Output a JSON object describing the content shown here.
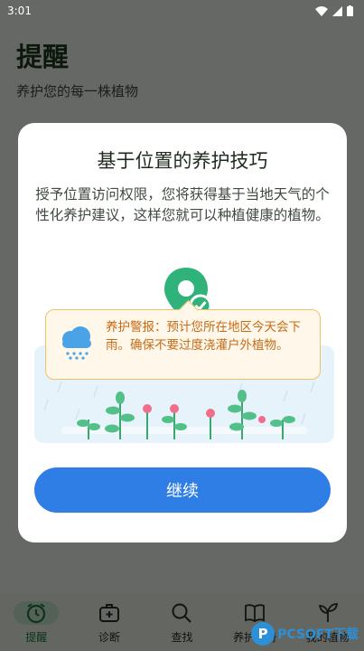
{
  "status_bar": {
    "time": "3:01"
  },
  "header": {
    "title": "提醒",
    "subtitle": "养护您的每一株植物"
  },
  "dialog": {
    "title": "基于位置的养护技巧",
    "body": "授予位置访问权限，您将获得基于当地天气的个性化养护建议，这样您就可以种植健康的植物。",
    "alert_text": "养护警报：预计您所在地区今天会下雨。确保不要过度浇灌户外植物。",
    "continue_label": "继续"
  },
  "bottom_nav": {
    "items": [
      {
        "label": "提醒",
        "icon": "alarm-clock-icon",
        "active": true
      },
      {
        "label": "诊断",
        "icon": "medical-kit-icon",
        "active": false
      },
      {
        "label": "查找",
        "icon": "search-icon",
        "active": false
      },
      {
        "label": "养护手册",
        "icon": "book-icon",
        "active": false
      },
      {
        "label": "我的植物",
        "icon": "sprout-icon",
        "active": false
      }
    ]
  },
  "watermark": {
    "text": "PCSOFT下载"
  },
  "colors": {
    "primary_button": "#2f7ee6",
    "alert_text": "#c76a16",
    "pin_green": "#2fb37a"
  }
}
